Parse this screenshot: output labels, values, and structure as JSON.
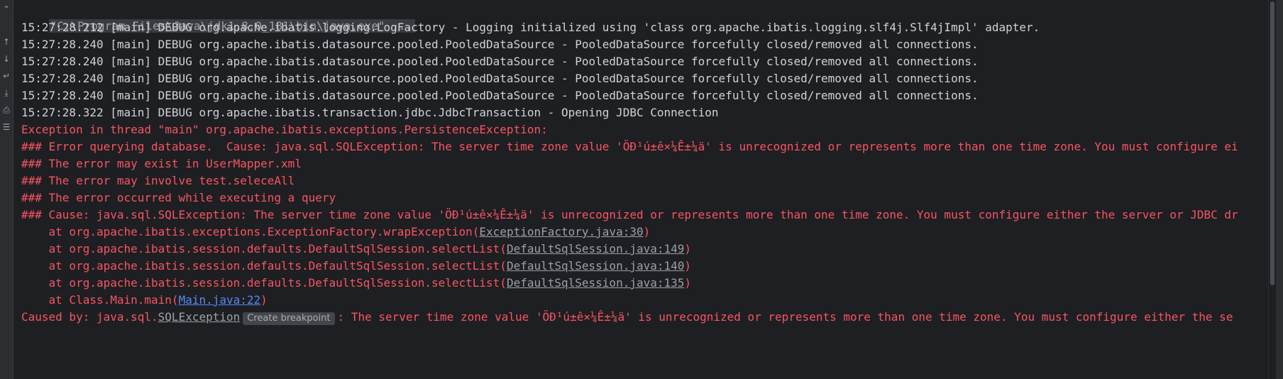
{
  "gutter": {
    "icons": [
      "chevron-up-icon",
      "arrow-up-icon",
      "arrow-down-icon",
      "soft-wrap-icon",
      "scroll-to-end-icon",
      "print-icon",
      "trash-icon"
    ]
  },
  "console": {
    "command_line": "\"C:\\Program Files\\Java\\jdk1.8.0_181\\bin\\java.exe\" ...",
    "debug_lines": [
      "15:27:28.212 [main] DEBUG org.apache.ibatis.logging.LogFactory - Logging initialized using 'class org.apache.ibatis.logging.slf4j.Slf4jImpl' adapter.",
      "15:27:28.240 [main] DEBUG org.apache.ibatis.datasource.pooled.PooledDataSource - PooledDataSource forcefully closed/removed all connections.",
      "15:27:28.240 [main] DEBUG org.apache.ibatis.datasource.pooled.PooledDataSource - PooledDataSource forcefully closed/removed all connections.",
      "15:27:28.240 [main] DEBUG org.apache.ibatis.datasource.pooled.PooledDataSource - PooledDataSource forcefully closed/removed all connections.",
      "15:27:28.240 [main] DEBUG org.apache.ibatis.datasource.pooled.PooledDataSource - PooledDataSource forcefully closed/removed all connections.",
      "15:27:28.322 [main] DEBUG org.apache.ibatis.transaction.jdbc.JdbcTransaction - Opening JDBC Connection"
    ],
    "error_lines": [
      "Exception in thread \"main\" org.apache.ibatis.exceptions.PersistenceException: ",
      "### Error querying database.  Cause: java.sql.SQLException: The server time zone value 'ÖÐ¹ú±ê×¼Ê±¼ä' is unrecognized or represents more than one time zone. You must configure ei",
      "### The error may exist in UserMapper.xml",
      "### The error may involve test.seleceAll",
      "### The error occurred while executing a query",
      "### Cause: java.sql.SQLException: The server time zone value 'ÖÐ¹ú±ê×¼Ê±¼ä' is unrecognized or represents more than one time zone. You must configure either the server or JDBC dr"
    ],
    "stack": [
      {
        "prefix": "    at org.apache.ibatis.exceptions.ExceptionFactory.wrapException(",
        "link": "ExceptionFactory.java:30",
        "suffix": ")"
      },
      {
        "prefix": "    at org.apache.ibatis.session.defaults.DefaultSqlSession.selectList(",
        "link": "DefaultSqlSession.java:149",
        "suffix": ")"
      },
      {
        "prefix": "    at org.apache.ibatis.session.defaults.DefaultSqlSession.selectList(",
        "link": "DefaultSqlSession.java:140",
        "suffix": ")"
      },
      {
        "prefix": "    at org.apache.ibatis.session.defaults.DefaultSqlSession.selectList(",
        "link": "DefaultSqlSession.java:135",
        "suffix": ")"
      },
      {
        "prefix": "    at Class.Main.main(",
        "link": "Main.java:22",
        "suffix": ")"
      }
    ],
    "caused_by": {
      "prefix": "Caused by: java.sql.",
      "link": "SQLException",
      "tooltip": "Create breakpoint",
      "suffix": ": The server time zone value 'ÖÐ¹ú±ê×¼Ê±¼ä' is unrecognized or represents more than one time zone. You must configure either the se"
    },
    "colors": {
      "background": "#1e1f22",
      "debug_text": "#cfd2d6",
      "error_text": "#f75464",
      "link_user_code": "#548af7",
      "link_library": "#9da0a6"
    }
  }
}
